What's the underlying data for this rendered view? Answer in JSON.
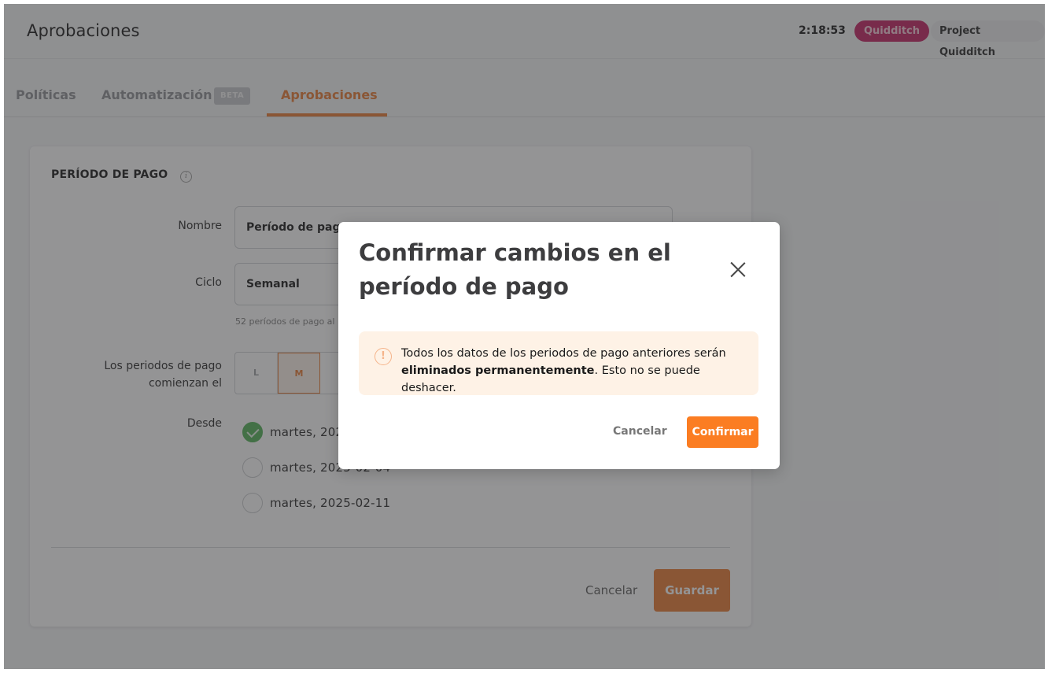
{
  "header": {
    "title": "Aprobaciones",
    "timer": "2:18:53",
    "team_badge": "Quidditch",
    "project_badge": "Project Quidditch"
  },
  "tabs": [
    {
      "label": "Políticas",
      "active": false
    },
    {
      "label": "Automatización",
      "badge": "BETA",
      "active": false
    },
    {
      "label": "Aprobaciones",
      "active": true
    }
  ],
  "colors": {
    "accent": "#e8762c",
    "team_badge": "#c2185b",
    "success": "#4caf50",
    "alert_bg": "#fef2e6"
  },
  "form": {
    "section_title": "PERÍODO DE PAGO",
    "info_icon": "info-icon",
    "name_label": "Nombre",
    "name_value": "Período de pago",
    "cycle_label": "Ciclo",
    "cycle_value": "Semanal",
    "cycle_helper": "52 períodos de pago al",
    "start_label_line1": "Los periodos de pago",
    "start_label_line2": "comienzan el",
    "days": [
      {
        "label": "L",
        "selected": false
      },
      {
        "label": "M",
        "selected": true
      }
    ],
    "from_label": "Desde",
    "from_options": [
      {
        "label": "martes, 202",
        "checked": true
      },
      {
        "label": "martes, 2025-02-04",
        "checked": false
      },
      {
        "label": "martes, 2025-02-11",
        "checked": false
      }
    ],
    "cancel_label": "Cancelar",
    "save_label": "Guardar"
  },
  "modal": {
    "title": "Confirmar cambios en el período de pago",
    "alert_text_prefix": "Todos los datos de los periodos de pago anteriores serán ",
    "alert_text_bold": "eliminados permanentemente",
    "alert_text_suffix": ". Esto no se puede deshacer.",
    "cancel_label": "Cancelar",
    "confirm_label": "Confirmar"
  }
}
